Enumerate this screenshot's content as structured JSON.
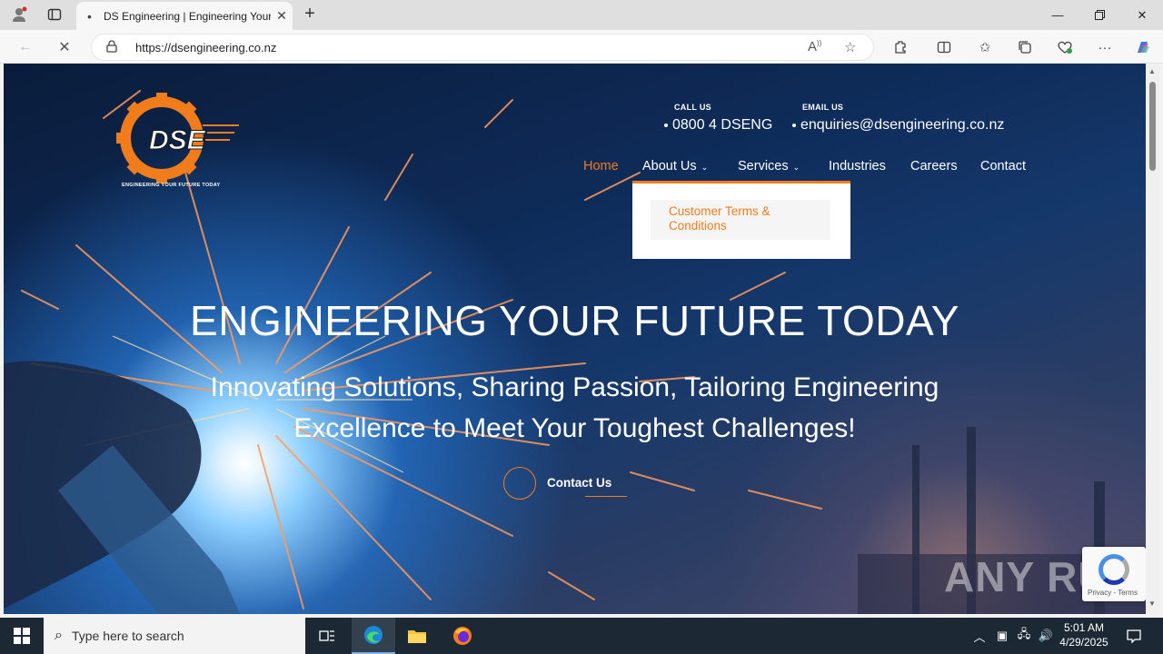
{
  "browser": {
    "tab_title": "DS Engineering | Engineering Your Future Today",
    "url": "https://dsengineering.co.nz",
    "new_tab_icon": "plus-icon",
    "close_tab_icon": "close-icon"
  },
  "site": {
    "logo_text": "DSE",
    "logo_tagline": "ENGINEERING YOUR FUTURE TODAY",
    "call_label": "CALL US",
    "call_value": "0800 4 DSENG",
    "email_label": "EMAIL US",
    "email_value": "enquiries@dsengineering.co.nz",
    "menu": {
      "home": "Home",
      "about": "About Us",
      "services": "Services",
      "industries": "Industries",
      "careers": "Careers",
      "contact": "Contact"
    },
    "dropdown_item": "Customer Terms & Conditions",
    "hero_title": "ENGINEERING YOUR FUTURE TODAY",
    "hero_subtitle": "Innovating Solutions, Sharing Passion, Tailoring Engineering Excellence to Meet Your Toughest Challenges!",
    "cta_label": "Contact Us",
    "recaptcha_text": "Privacy - Terms",
    "watermark": "ANY RUN",
    "accent_color": "#f07c1c"
  },
  "taskbar": {
    "search_placeholder": "Type here to search",
    "time": "5:01 AM",
    "date": "4/29/2025"
  }
}
